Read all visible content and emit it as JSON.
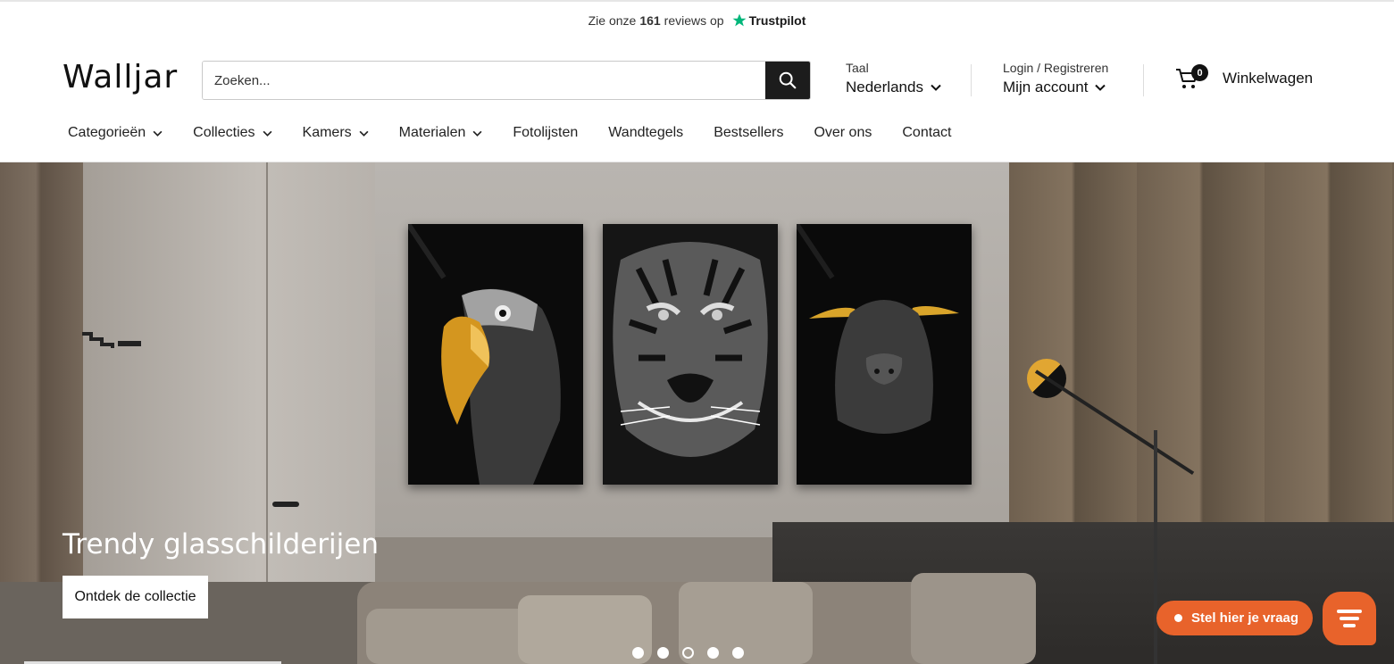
{
  "topbar": {
    "prefix": "Zie onze",
    "count": "161",
    "suffix": "reviews op",
    "brand": "Trustpilot",
    "brand_color": "#00b67a"
  },
  "header": {
    "logo": "Walljar",
    "search": {
      "placeholder": "Zoeken...",
      "icon": "search-icon"
    },
    "language": {
      "label": "Taal",
      "value": "Nederlands"
    },
    "account": {
      "label": "Login / Registreren",
      "value": "Mijn account"
    },
    "cart": {
      "count": "0",
      "label": "Winkelwagen",
      "icon": "cart-icon"
    }
  },
  "nav": {
    "items": [
      {
        "label": "Categorieën",
        "dropdown": true
      },
      {
        "label": "Collecties",
        "dropdown": true
      },
      {
        "label": "Kamers",
        "dropdown": true
      },
      {
        "label": "Materialen",
        "dropdown": true
      },
      {
        "label": "Fotolijsten",
        "dropdown": false
      },
      {
        "label": "Wandtegels",
        "dropdown": false
      },
      {
        "label": "Bestsellers",
        "dropdown": false
      },
      {
        "label": "Over ons",
        "dropdown": false
      },
      {
        "label": "Contact",
        "dropdown": false
      }
    ]
  },
  "hero": {
    "title": "Trendy glasschilderijen",
    "button": "Ontdek de collectie",
    "slides": 5,
    "active_slide": 3
  },
  "chat": {
    "label": "Stel hier je vraag",
    "accent": "#e8632b"
  }
}
